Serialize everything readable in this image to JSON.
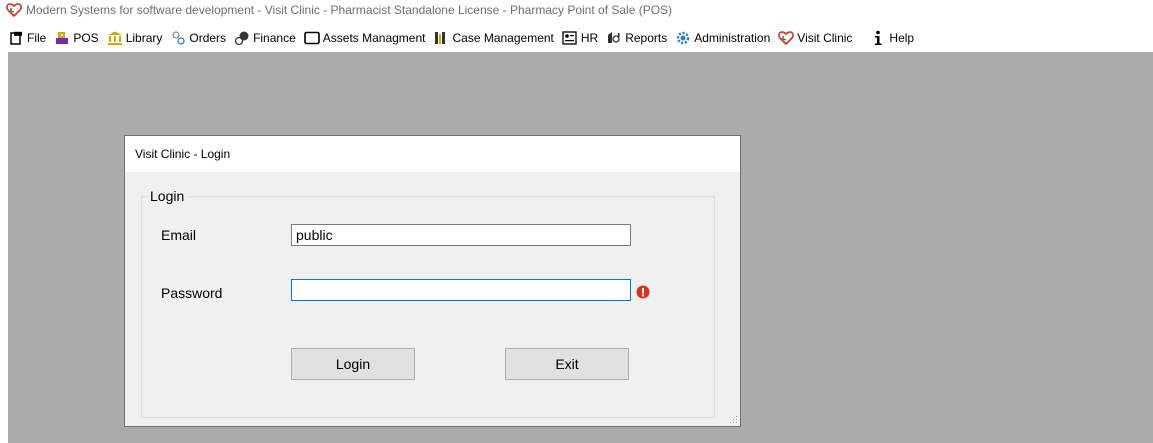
{
  "window": {
    "title": "Modern Systems for software development - Visit Clinic - Pharmacist Standalone License - Pharmacy Point of Sale (POS)",
    "app_icon": "heart-stethoscope-icon"
  },
  "menu": [
    {
      "label": "File",
      "icon": "file-icon"
    },
    {
      "label": "POS",
      "icon": "pos-icon"
    },
    {
      "label": "Library",
      "icon": "library-icon"
    },
    {
      "label": "Orders",
      "icon": "orders-icon"
    },
    {
      "label": "Finance",
      "icon": "finance-icon"
    },
    {
      "label": "Assets Managment",
      "icon": "assets-icon"
    },
    {
      "label": "Case Management",
      "icon": "case-icon"
    },
    {
      "label": "HR",
      "icon": "hr-icon"
    },
    {
      "label": "Reports",
      "icon": "reports-icon"
    },
    {
      "label": "Administration",
      "icon": "gear-icon"
    },
    {
      "label": "Visit Clinic",
      "icon": "heart-stethoscope-icon"
    },
    {
      "label": "Help",
      "icon": "info-icon"
    }
  ],
  "dialog": {
    "title": "Visit Clinic - Login",
    "group_label": "Login",
    "email_label": "Email",
    "email_value": "public",
    "password_label": "Password",
    "password_value": "",
    "login_button": "Login",
    "exit_button": "Exit"
  },
  "colors": {
    "workspace": "#ababab",
    "dialog_bg": "#f0f0f0",
    "focus_border": "#0078d7",
    "error": "#d9331f"
  }
}
